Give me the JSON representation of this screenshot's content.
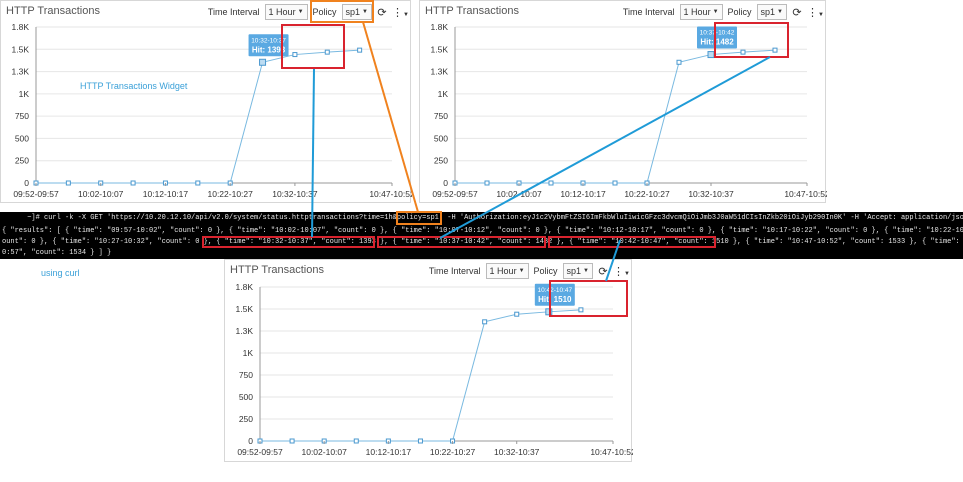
{
  "widgets": [
    {
      "title": "HTTP Transactions",
      "controls": {
        "time_interval_label": "Time Interval",
        "time_interval_value": "1 Hour",
        "policy_label": "Policy",
        "policy_value": "sp1",
        "refresh_icon": "refresh-icon",
        "menu_icon": "kebab-menu-icon"
      },
      "tooltip": {
        "time": "10:32-10:37",
        "hit_label": "Hit:",
        "hit_value": "1393"
      },
      "watermark": "HTTP Transactions Widget"
    },
    {
      "title": "HTTP Transactions",
      "controls": {
        "time_interval_label": "Time Interval",
        "time_interval_value": "1 Hour",
        "policy_label": "Policy",
        "policy_value": "sp1",
        "refresh_icon": "refresh-icon",
        "menu_icon": "kebab-menu-icon"
      },
      "tooltip": {
        "time": "10:37-10:42",
        "hit_label": "Hit:",
        "hit_value": "1482"
      }
    },
    {
      "title": "HTTP Transactions",
      "controls": {
        "time_interval_label": "Time Interval",
        "time_interval_value": "1 Hour",
        "policy_label": "Policy",
        "policy_value": "sp1",
        "refresh_icon": "refresh-icon",
        "menu_icon": "kebab-menu-icon"
      },
      "tooltip": {
        "time": "10:42-10:47",
        "hit_label": "Hit:",
        "hit_value": "1510"
      }
    }
  ],
  "terminal": {
    "line1": "      ~]# curl -k -X GET 'https://10.20.12.10/api/v2.0/system/status.httptransactions?time=1h&policy=sp1' -H 'Authorization:eyJ1c2VybmFtZSI6ImFkbWluIiwicGFzc3dvcmQiOiJmb3J0aW51dCIsInZkb20iOiJyb290In0K' -H 'Accept: application/json'",
    "line2": "{ \"results\": [ { \"time\": \"09:57-10:02\", \"count\": 0 }, { \"time\": \"10:02-10:07\", \"count\": 0 }, { \"time\": \"10:07-10:12\", \"count\": 0 }, { \"time\": \"10:12-10:17\", \"count\": 0 }, { \"time\": \"10:17-10:22\", \"count\": 0 }, { \"time\": \"10:22-10:27\", \"c",
    "line3": "ount\": 0 }, { \"time\": \"10:27-10:32\", \"count\": 0 }, { \"time\": \"10:32-10:37\", \"count\": 1393 }, { \"time\": \"10:37-10:42\", \"count\": 1482 }, { \"time\": \"10:42-10:47\", \"count\": 1510 }, { \"time\": \"10:47-10:52\", \"count\": 1533 }, { \"time\": \"10:52-1",
    "line4": "0:57\", \"count\": 1534 } ] }"
  },
  "note": "using curl",
  "chart_data": [
    {
      "type": "line",
      "x_tick_labels": [
        "09:52-09:57",
        "10:02-10:07",
        "10:12-10:17",
        "10:22-10:27",
        "10:32-10:37",
        "10:47-10:52"
      ],
      "y_tick_labels": [
        "0",
        "250",
        "500",
        "750",
        "1K",
        "1.3K",
        "1.5K",
        "1.8K"
      ],
      "ylim": [
        0,
        1800
      ],
      "series": [
        {
          "values": [
            0,
            0,
            0,
            0,
            0,
            0,
            0,
            1393,
            1482,
            1510,
            1533
          ]
        }
      ],
      "highlight_index": 7
    },
    {
      "type": "line",
      "x_tick_labels": [
        "09:52-09:57",
        "10:02-10:07",
        "10:12-10:17",
        "10:22-10:27",
        "10:32-10:37",
        "10:47-10:52"
      ],
      "y_tick_labels": [
        "0",
        "250",
        "500",
        "750",
        "1K",
        "1.3K",
        "1.5K",
        "1.8K"
      ],
      "ylim": [
        0,
        1800
      ],
      "series": [
        {
          "values": [
            0,
            0,
            0,
            0,
            0,
            0,
            0,
            1393,
            1482,
            1510,
            1533
          ]
        }
      ],
      "highlight_index": 8
    },
    {
      "type": "line",
      "x_tick_labels": [
        "09:52-09:57",
        "10:02-10:07",
        "10:12-10:17",
        "10:22-10:27",
        "10:32-10:37",
        "10:47-10:52"
      ],
      "y_tick_labels": [
        "0",
        "250",
        "500",
        "750",
        "1K",
        "1.3K",
        "1.5K",
        "1.8K"
      ],
      "ylim": [
        0,
        1800
      ],
      "series": [
        {
          "values": [
            0,
            0,
            0,
            0,
            0,
            0,
            0,
            1393,
            1482,
            1510,
            1533
          ]
        }
      ],
      "highlight_index": 9
    }
  ],
  "colors": {
    "line": "#79b9e0",
    "marker": "#4a98cf",
    "tooltip_bg": "#5aa9e2",
    "annotation_red": "#d9232e",
    "annotation_orange": "#f0821e",
    "connector_blue": "#1f9bd7",
    "note_text": "#3aa0d8"
  }
}
